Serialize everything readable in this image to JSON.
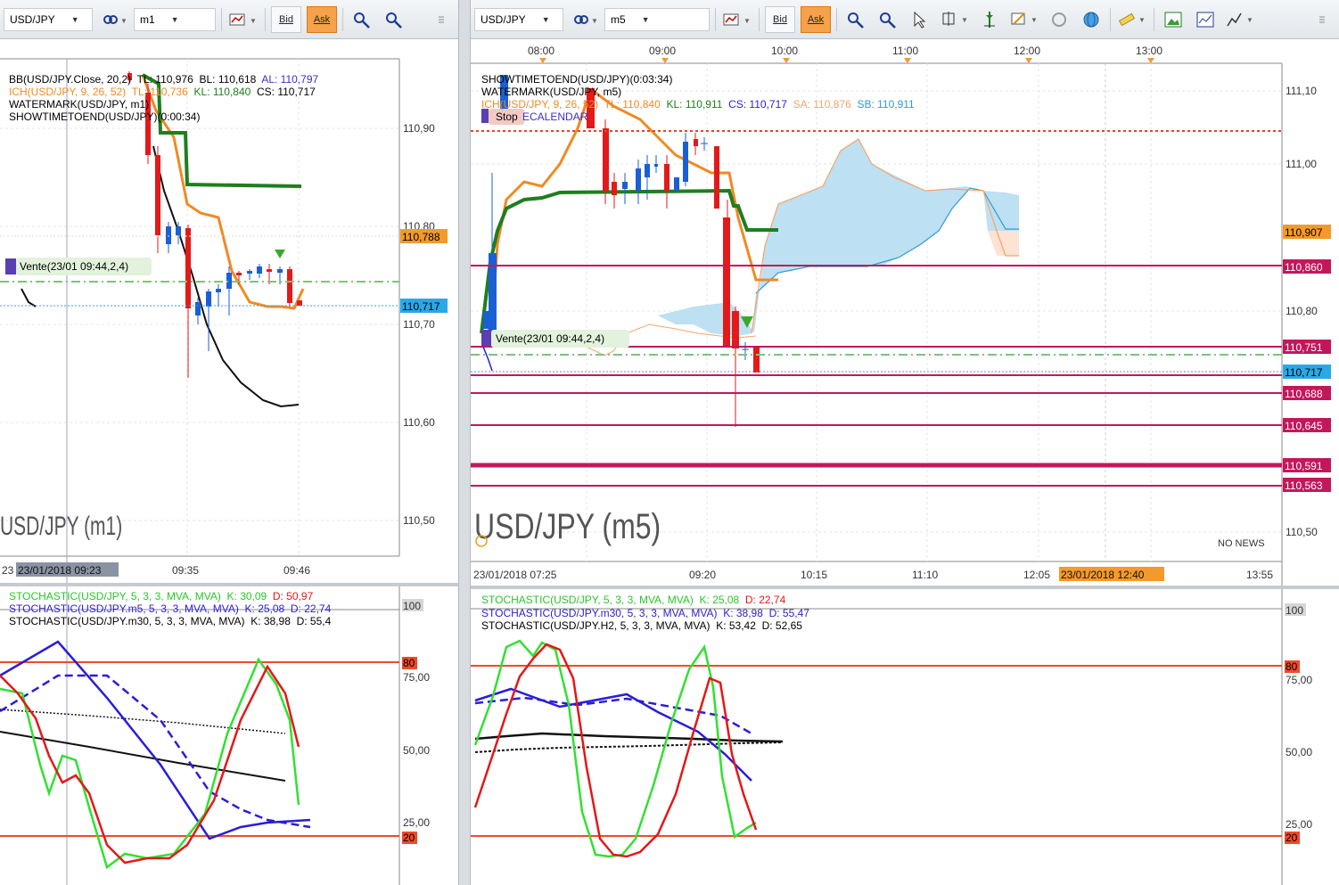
{
  "left": {
    "toolbar": {
      "symbol": "USD/JPY",
      "timeframe": "m1",
      "bid_label": "Bid",
      "ask_label": "Ask"
    },
    "legend": {
      "bb_prefix": "BB(USD/JPY.Close, 20,2)",
      "bb_tl": "TL: 110,976",
      "bb_bl": "BL: 110,618",
      "bb_al": "AL: 110,797",
      "ich_prefix": "ICH(USD/JPY, 9, 26, 52)",
      "ich_tl": "TL: 110,736",
      "ich_kl": "KL: 110,840",
      "ich_cs": "CS: 110,717",
      "watermark": "WATERMARK(USD/JPY, m1)",
      "showtime": "SHOWTIMETOEND(USD/JPY)(0:00:34)"
    },
    "order_label": "Vente(23/01 09:44,2,4)",
    "watermark_text": "USD/JPY (m1)",
    "price_axis": [
      "110,90",
      "110,80",
      "110,70",
      "110,60",
      "110,50"
    ],
    "tag_orange": "110,788",
    "tag_blue": "110,717",
    "time_axis": {
      "start": "23",
      "cursor": "23/01/2018 09:23",
      "t2": "09:35",
      "t3": "09:46"
    },
    "stoch_legend": {
      "l1": "STOCHASTIC(USD/JPY, 5, 3, 3, MVA, MVA)",
      "l1_k": "K: 30,09",
      "l1_d": "D: 50,97",
      "l2": "STOCHASTIC(USD/JPY.m5, 5, 3, 3, MVA, MVA)",
      "l2_k": "K: 25,08",
      "l2_d": "D: 22,74",
      "l3": "STOCHASTIC(USD/JPY.m30, 5, 3, 3, MVA, MVA)",
      "l3_k": "K: 38,98",
      "l3_d": "D: 55,4"
    },
    "stoch_axis": {
      "top": "100",
      "l80": "80",
      "l75": "75,00",
      "l50": "50,00",
      "l25": "25,00",
      "l20": "20"
    }
  },
  "right": {
    "toolbar": {
      "symbol": "USD/JPY",
      "timeframe": "m5",
      "bid_label": "Bid",
      "ask_label": "Ask"
    },
    "top_times": [
      "08:00",
      "09:00",
      "10:00",
      "11:00",
      "12:00",
      "13:00"
    ],
    "legend": {
      "showtime": "SHOWTIMETOEND(USD/JPY)(0:03:34)",
      "watermark": "WATERMARK(USD/JPY, m5)",
      "ich_prefix": "ICH(USD/JPY, 9, 26, 52)",
      "ich_tl": "TL: 110,840",
      "ich_kl": "KL: 110,911",
      "ich_cs": "CS: 110,717",
      "ich_sa": "SA: 110,876",
      "ich_sb": "SB: 110,911",
      "calendar": "ECALENDAR",
      "stop": "Stop"
    },
    "order_label": "Vente(23/01 09:44,2,4)",
    "watermark_text": "USD/JPY (m5)",
    "no_news": "NO NEWS",
    "price_axis": [
      "111,10",
      "111,00",
      "110,80",
      "110,50"
    ],
    "tags": [
      {
        "value": "110,907",
        "color": "#f39a2a"
      },
      {
        "value": "110,860",
        "color": "#c2185b"
      },
      {
        "value": "110,751",
        "color": "#c2185b"
      },
      {
        "value": "110,717",
        "color": "#29a9e6"
      },
      {
        "value": "110,688",
        "color": "#c2185b"
      },
      {
        "value": "110,645",
        "color": "#c2185b"
      },
      {
        "value": "110,591",
        "color": "#c2185b"
      },
      {
        "value": "110,563",
        "color": "#c2185b"
      }
    ],
    "time_axis": {
      "t1": "23/01/2018 07:25",
      "t2": "09:20",
      "t3": "10:15",
      "t4": "11:10",
      "t5": "12:05",
      "cursor": "23/01/2018 12:40",
      "t6": "13:55"
    },
    "stoch_legend": {
      "l1": "STOCHASTIC(USD/JPY, 5, 3, 3, MVA, MVA)",
      "l1_k": "K: 25,08",
      "l1_d": "D: 22,74",
      "l2": "STOCHASTIC(USD/JPY.m30, 5, 3, 3, MVA, MVA)",
      "l2_k": "K: 38,98",
      "l2_d": "D: 55,47",
      "l3": "STOCHASTIC(USD/JPY.H2, 5, 3, 3, MVA, MVA)",
      "l3_k": "K: 53,42",
      "l3_d": "D: 52,65"
    },
    "stoch_axis": {
      "top": "100",
      "l80": "80",
      "l75": "75,00",
      "l50": "50,00",
      "l25": "25,00",
      "l20": "20"
    }
  },
  "colors": {
    "ask_orange": "#f5a24a",
    "kijun_green": "#1e7e1e",
    "tenkan_orange": "#f08a24",
    "level_magenta": "#c2185b",
    "kumo_blue": "#bde0f2"
  }
}
